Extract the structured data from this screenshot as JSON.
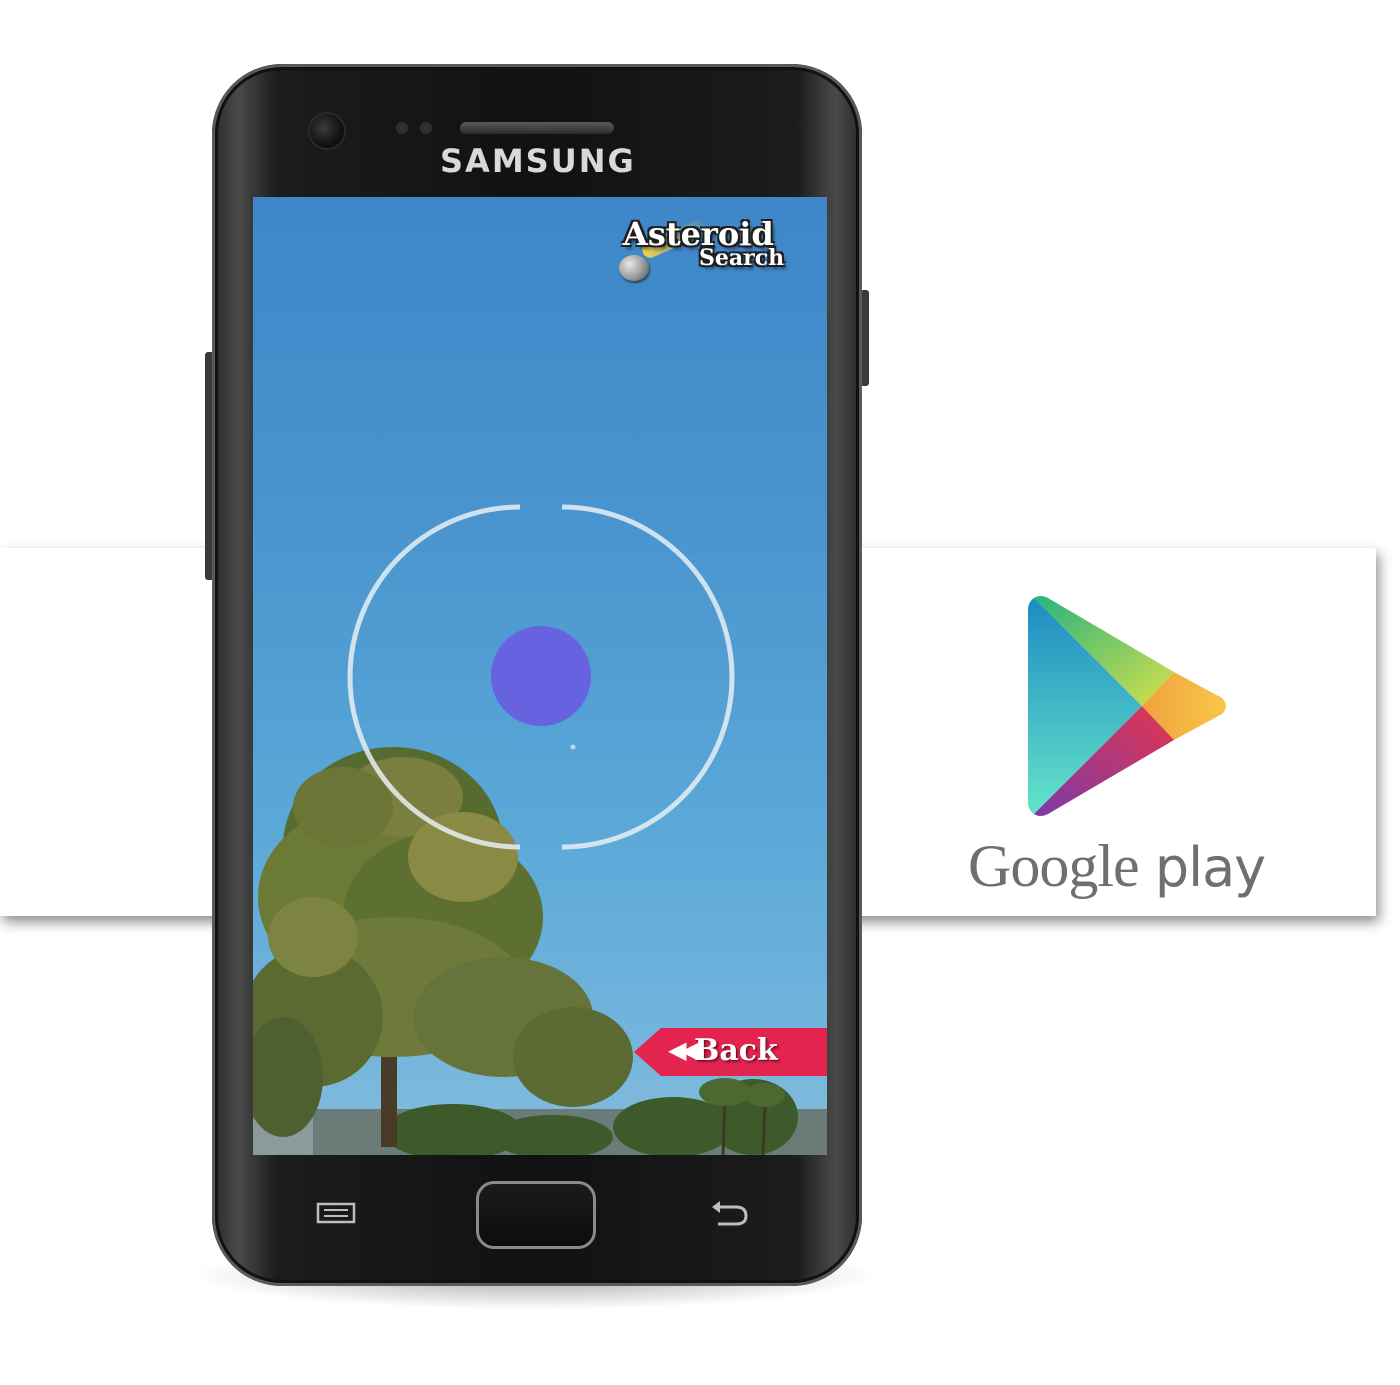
{
  "phone": {
    "brand": "SAMSUNG"
  },
  "app": {
    "logo_line1": "Asteroid",
    "logo_line2": "Search",
    "back_button_label": "Back",
    "back_button_icon": "double-chevron-left-icon",
    "target_dot_color": "#6762e0",
    "reticle_color": "#e6eef3",
    "back_button_color": "#e2244f"
  },
  "banner": {
    "wordmark_google": "Google",
    "wordmark_play": "play",
    "logo_icon": "google-play-triangle-icon"
  },
  "nav_keys": {
    "menu_icon": "menu-icon",
    "home_icon": "home-button",
    "back_icon": "return-arrow-icon"
  }
}
